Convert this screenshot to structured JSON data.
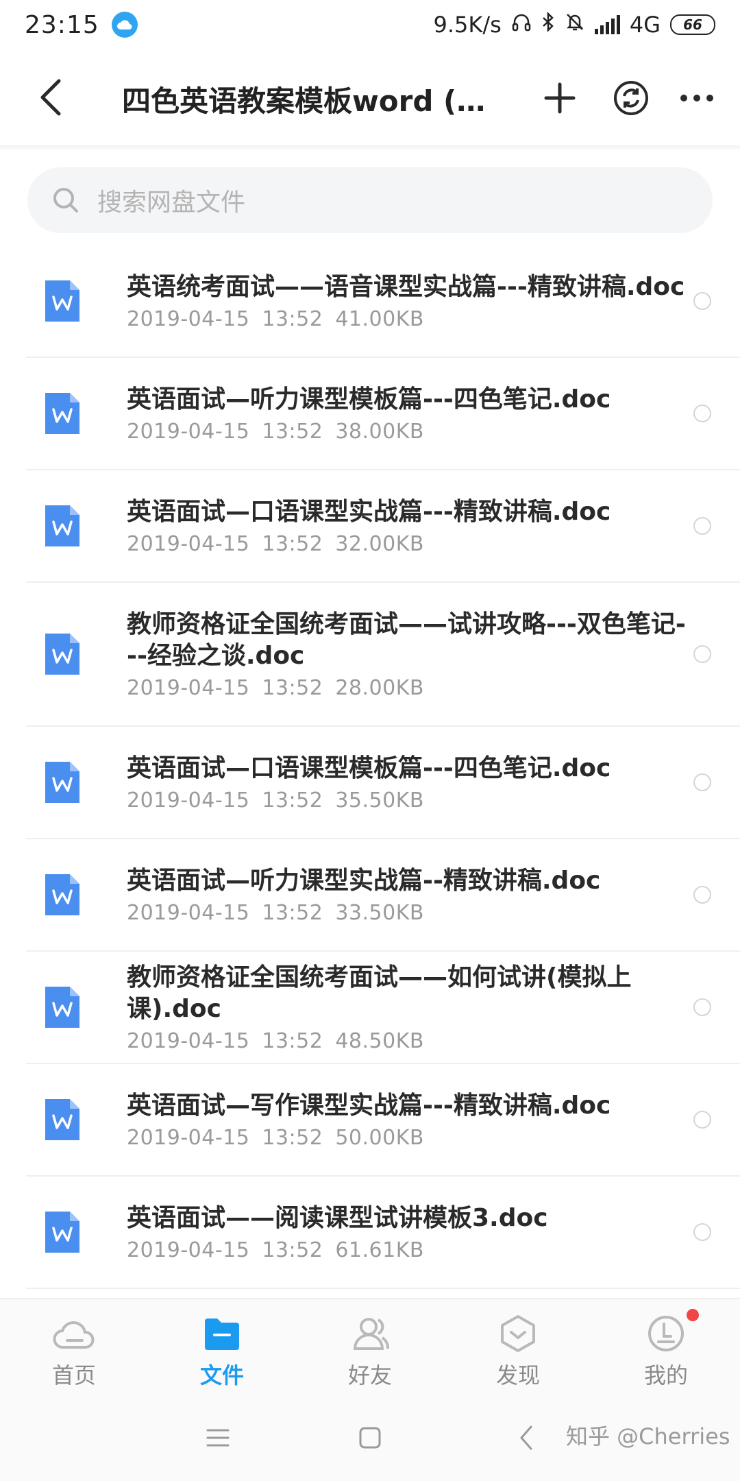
{
  "status_bar": {
    "time": "23:15",
    "network_speed": "9.5K/s",
    "network_type": "4G",
    "battery": "66"
  },
  "header": {
    "title": "四色英语教案模板word (按...",
    "icons": [
      "back-icon",
      "plus-icon",
      "sync-icon",
      "more-icon"
    ]
  },
  "search": {
    "placeholder": "搜索网盘文件"
  },
  "files": [
    {
      "name": "英语统考面试——语音课型实战篇---精致讲稿.doc",
      "date": "2019-04-15",
      "time": "13:52",
      "size": "41.00KB"
    },
    {
      "name": "英语面试—听力课型模板篇---四色笔记.doc",
      "date": "2019-04-15",
      "time": "13:52",
      "size": "38.00KB"
    },
    {
      "name": "英语面试—口语课型实战篇---精致讲稿.doc",
      "date": "2019-04-15",
      "time": "13:52",
      "size": "32.00KB"
    },
    {
      "name": "教师资格证全国统考面试——试讲攻略---双色笔记---经验之谈.doc",
      "date": "2019-04-15",
      "time": "13:52",
      "size": "28.00KB"
    },
    {
      "name": "英语面试—口语课型模板篇---四色笔记.doc",
      "date": "2019-04-15",
      "time": "13:52",
      "size": "35.50KB"
    },
    {
      "name": "英语面试—听力课型实战篇--精致讲稿.doc",
      "date": "2019-04-15",
      "time": "13:52",
      "size": "33.50KB"
    },
    {
      "name": "教师资格证全国统考面试——如何试讲(模拟上课).doc",
      "date": "2019-04-15",
      "time": "13:52",
      "size": "48.50KB"
    },
    {
      "name": "英语面试—写作课型实战篇---精致讲稿.doc",
      "date": "2019-04-15",
      "time": "13:52",
      "size": "50.00KB"
    },
    {
      "name": "英语面试——阅读课型试讲模板3.doc",
      "date": "2019-04-15",
      "time": "13:52",
      "size": "61.61KB"
    }
  ],
  "tabs": [
    {
      "label": "首页",
      "icon": "cloud-icon"
    },
    {
      "label": "文件",
      "icon": "folder-icon"
    },
    {
      "label": "好友",
      "icon": "friends-icon"
    },
    {
      "label": "发现",
      "icon": "discover-icon"
    },
    {
      "label": "我的",
      "icon": "profile-icon"
    }
  ],
  "watermark": "知乎 @Cherries",
  "colors": {
    "accent": "#1a9bf0",
    "doc_icon": "#4a8ef0",
    "badge": "#f24545"
  }
}
